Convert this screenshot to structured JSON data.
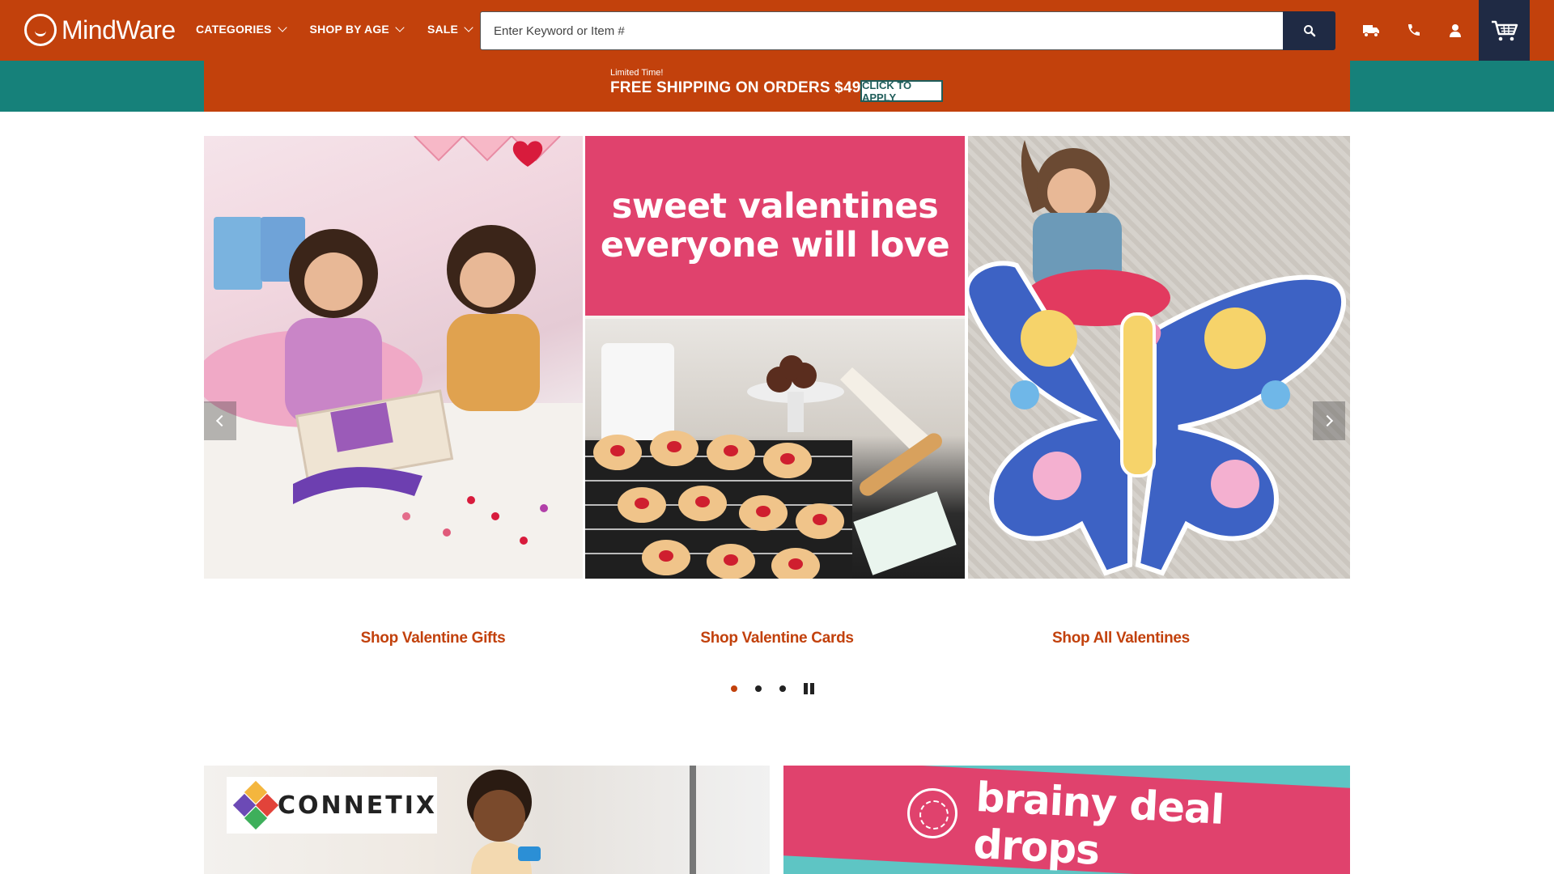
{
  "header": {
    "logo_text": "MindWare",
    "nav": [
      {
        "label": "CATEGORIES"
      },
      {
        "label": "SHOP BY AGE"
      },
      {
        "label": "SALE"
      }
    ],
    "search_placeholder": "Enter Keyword or Item #",
    "utility_icons": [
      "truck-icon",
      "phone-icon",
      "account-icon",
      "cart-icon"
    ]
  },
  "promo": {
    "small_text": "Limited Time!",
    "headline": "FREE SHIPPING ON ORDERS $49+",
    "button_label": "CLICK TO APPLY"
  },
  "carousel": {
    "slide2_headline_line1": "sweet valentines",
    "slide2_headline_line2": "everyone will love",
    "links": [
      {
        "label": "Shop Valentine Gifts"
      },
      {
        "label": "Shop Valentine Cards"
      },
      {
        "label": "Shop All Valentines"
      }
    ],
    "dots_count": 3,
    "active_dot": 1
  },
  "banners": {
    "connetix_logo": "CONNETIX",
    "brainy_text": "brainy deal drops"
  },
  "colors": {
    "brand_orange": "#c2410c",
    "navy": "#1f2a44",
    "teal": "#16817a",
    "pink": "#e0426d"
  }
}
